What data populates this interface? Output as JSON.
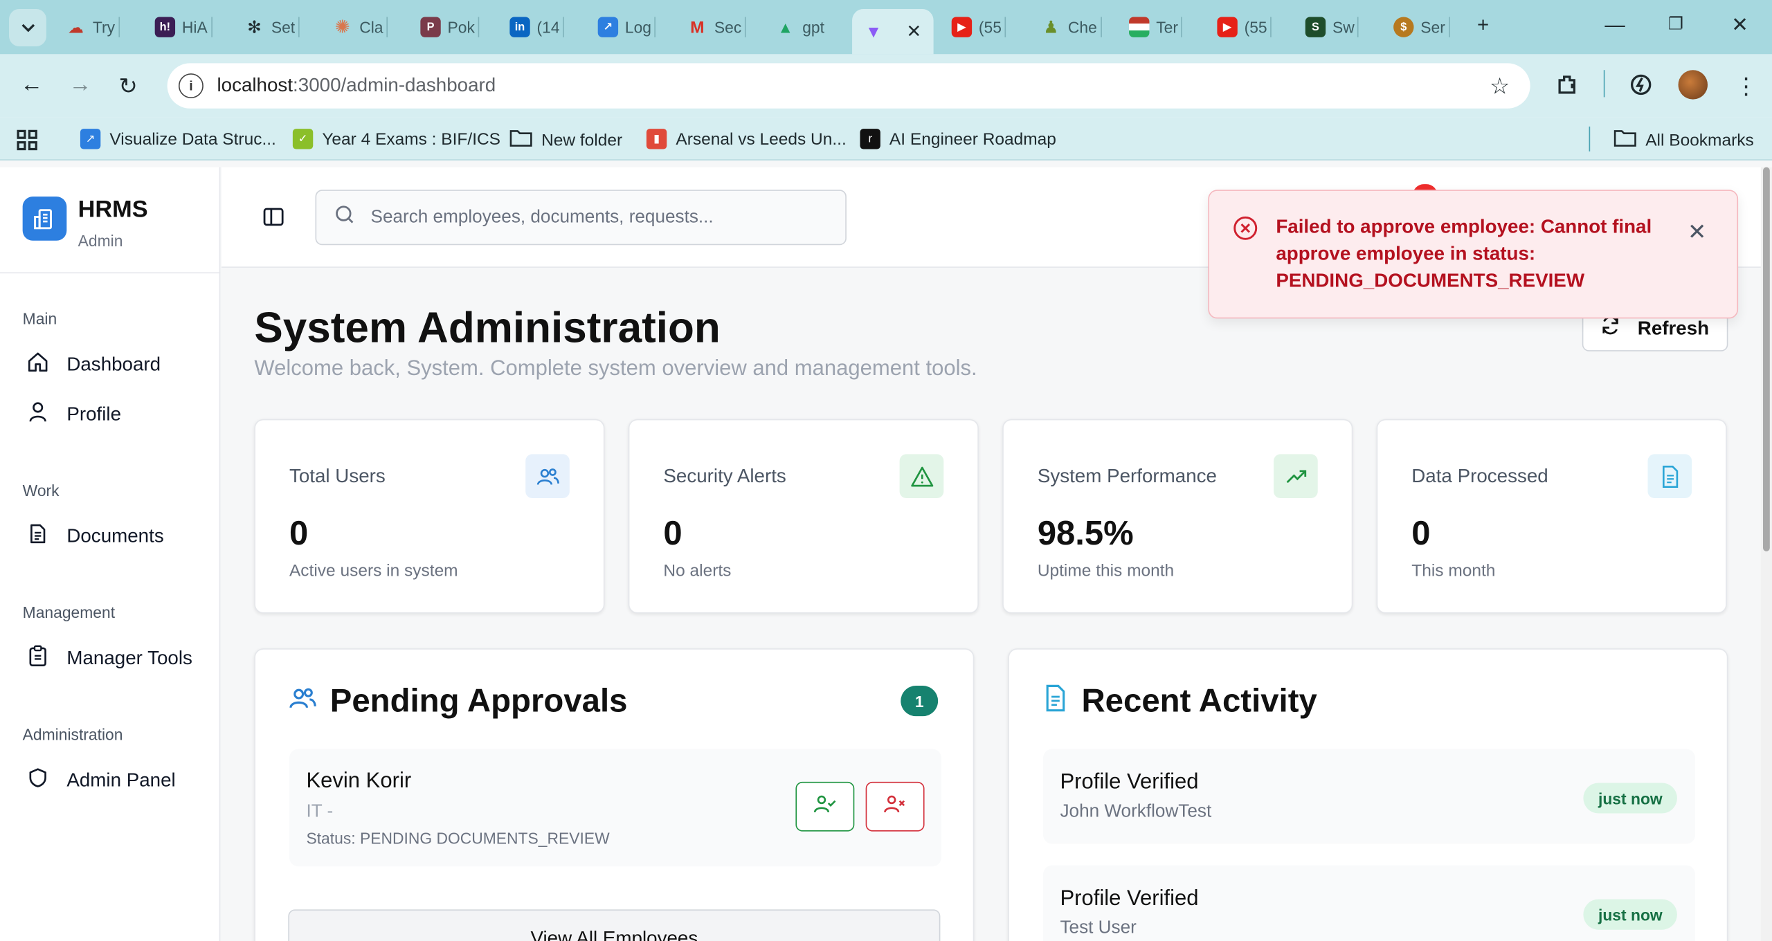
{
  "browser": {
    "tabs": [
      {
        "label": "Try",
        "icon": "cloud-icon"
      },
      {
        "label": "HiA",
        "icon": "h-icon"
      },
      {
        "label": "Set",
        "icon": "openai-icon"
      },
      {
        "label": "Cla",
        "icon": "claude-icon"
      },
      {
        "label": "Pok",
        "icon": "pokemon-icon"
      },
      {
        "label": "(14",
        "icon": "linkedin-icon"
      },
      {
        "label": "Log",
        "icon": "login-icon"
      },
      {
        "label": "Sec",
        "icon": "gmail-icon"
      },
      {
        "label": "gpt",
        "icon": "drive-icon"
      },
      {
        "label": "",
        "icon": "vite-icon",
        "active": true
      },
      {
        "label": "(55",
        "icon": "youtube-icon"
      },
      {
        "label": "Che",
        "icon": "chess-icon"
      },
      {
        "label": "Ter",
        "icon": "flag-icon"
      },
      {
        "label": "(55",
        "icon": "youtube-icon"
      },
      {
        "label": "Sw",
        "icon": "sw-icon"
      },
      {
        "label": "Ser",
        "icon": "coin-icon"
      }
    ],
    "url_host": "localhost",
    "url_path": ":3000/admin-dashboard",
    "bookmarks": [
      {
        "label": "Visualize Data Struc...",
        "icon": "bookmark-blue-icon"
      },
      {
        "label": "Year 4 Exams : BIF/ICS",
        "icon": "bookmark-green-icon"
      },
      {
        "label": "New folder",
        "icon": "folder-icon"
      },
      {
        "label": "Arsenal vs Leeds Un...",
        "icon": "bookmark-red-icon"
      },
      {
        "label": "AI Engineer Roadmap",
        "icon": "bookmark-dark-icon"
      }
    ],
    "all_bookmarks": "All Bookmarks"
  },
  "sidebar": {
    "brand": "HRMS",
    "role": "Admin",
    "sections": [
      {
        "label": "Main",
        "items": [
          {
            "label": "Dashboard",
            "icon": "home-icon"
          },
          {
            "label": "Profile",
            "icon": "user-icon"
          }
        ]
      },
      {
        "label": "Work",
        "items": [
          {
            "label": "Documents",
            "icon": "document-icon"
          }
        ]
      },
      {
        "label": "Management",
        "items": [
          {
            "label": "Manager Tools",
            "icon": "clipboard-icon"
          }
        ]
      },
      {
        "label": "Administration",
        "items": [
          {
            "label": "Admin Panel",
            "icon": "shield-icon"
          }
        ]
      }
    ]
  },
  "search": {
    "placeholder": "Search employees, documents, requests..."
  },
  "header": {
    "title": "System Administration",
    "subtitle": "Welcome back, System. Complete system overview and management tools.",
    "refresh_label": "Refresh"
  },
  "stats": [
    {
      "label": "Total Users",
      "value": "0",
      "note": "Active users in system",
      "icon": "users-icon",
      "color": "#2a7fd0",
      "bg": "#e7f1fc"
    },
    {
      "label": "Security Alerts",
      "value": "0",
      "note": "No alerts",
      "icon": "alert-triangle-icon",
      "color": "#1f9440",
      "bg": "#e3f5e8"
    },
    {
      "label": "System Performance",
      "value": "98.5%",
      "note": "Uptime this month",
      "icon": "trending-up-icon",
      "color": "#1f9440",
      "bg": "#e3f5e8"
    },
    {
      "label": "Data Processed",
      "value": "0",
      "note": "This month",
      "icon": "file-icon",
      "color": "#2aa5d6",
      "bg": "#e5f4fb"
    }
  ],
  "pending": {
    "title": "Pending Approvals",
    "count": "1",
    "items": [
      {
        "name": "Kevin Korir",
        "dept": "IT -",
        "status": "Status: PENDING DOCUMENTS_REVIEW"
      }
    ],
    "view_all": "View All Employees"
  },
  "activity": {
    "title": "Recent Activity",
    "items": [
      {
        "title": "Profile Verified",
        "subject": "John WorkflowTest",
        "time": "just now"
      },
      {
        "title": "Profile Verified",
        "subject": "Test User",
        "time": "just now"
      }
    ]
  },
  "toast": {
    "message": "Failed to approve employee: Cannot final approve employee in status: PENDING_DOCUMENTS_REVIEW"
  },
  "colors": {
    "accent": "#2d7fe0",
    "teal": "#16826f",
    "error": "#b4111f"
  }
}
